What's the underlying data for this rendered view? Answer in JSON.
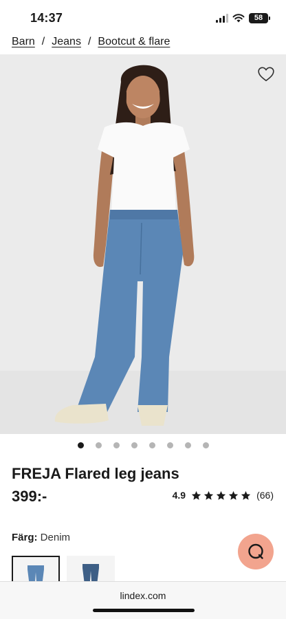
{
  "status_bar": {
    "time": "14:37",
    "battery": "58"
  },
  "breadcrumb": {
    "items": [
      "Barn",
      "Jeans",
      "Bootcut & flare"
    ],
    "separator": "/"
  },
  "product": {
    "title": "FREJA Flared leg jeans",
    "price": "399:-",
    "rating": {
      "score": "4.9",
      "review_count": "(66)",
      "stars": 5
    },
    "color": {
      "label": "Färg:",
      "value": "Denim"
    }
  },
  "gallery": {
    "total_images": 8,
    "active_index": 0
  },
  "browser": {
    "url": "lindex.com"
  },
  "colors": {
    "chat_button": "#f2a48e",
    "denim": "#5b87b6"
  }
}
